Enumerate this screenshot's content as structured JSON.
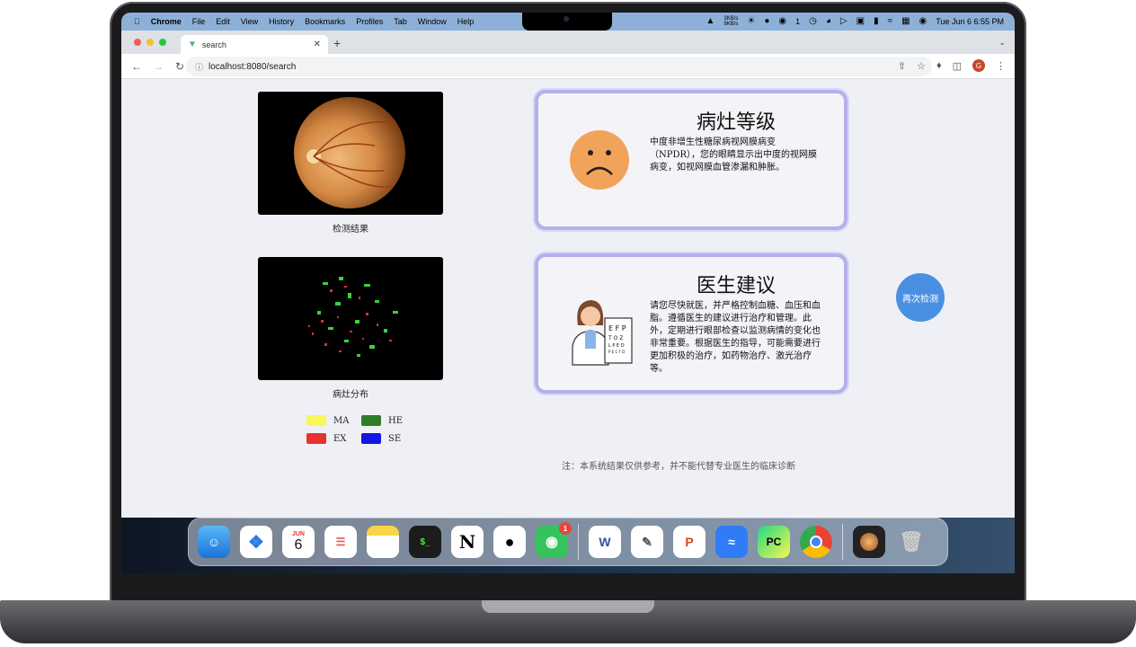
{
  "menubar": {
    "app_name": "Chrome",
    "menus": [
      "File",
      "Edit",
      "View",
      "History",
      "Bookmarks",
      "Profiles",
      "Tab",
      "Window",
      "Help"
    ],
    "net_speed": "3KB/s\n9KB/s",
    "wechat_count": "1",
    "datetime": "Tue Jun 6  6:55 PM"
  },
  "browser": {
    "tab_title": "search",
    "url": "localhost:8080/search"
  },
  "page": {
    "result_caption": "检测结果",
    "distribution_caption": "病灶分布",
    "legend": [
      {
        "label": "MA",
        "color": "#f7f75a"
      },
      {
        "label": "HE",
        "color": "#2f7d26"
      },
      {
        "label": "EX",
        "color": "#e8322d"
      },
      {
        "label": "SE",
        "color": "#1414e6"
      }
    ],
    "grade_card": {
      "title": "病灶等级",
      "text": "中度非增生性糖尿病视网膜病变（NPDR），您的眼睛显示出中度的视网膜病变，如视网膜血管渗漏和肿胀。"
    },
    "advice_card": {
      "title": "医生建议",
      "text": "请您尽快就医，并严格控制血糖、血压和血脂。遵循医生的建议进行治疗和管理。此外，定期进行眼部检查以监测病情的变化也非常重要。根据医生的指导，可能需要进行更加积极的治疗，如药物治疗、激光治疗等。"
    },
    "retest_button": "再次检测",
    "note": "注：本系统结果仅供参考，并不能代替专业医生的临床诊断"
  },
  "dock": {
    "calendar_month": "JUN",
    "calendar_day": "6",
    "wechat_badge": "1",
    "apps": [
      "finder",
      "safari",
      "calendar",
      "reminders",
      "notes",
      "terminal",
      "notion",
      "qq",
      "wechat",
      "word",
      "textedit",
      "powerpoint",
      "lark",
      "pycharm",
      "chrome",
      "preview",
      "trash"
    ]
  }
}
